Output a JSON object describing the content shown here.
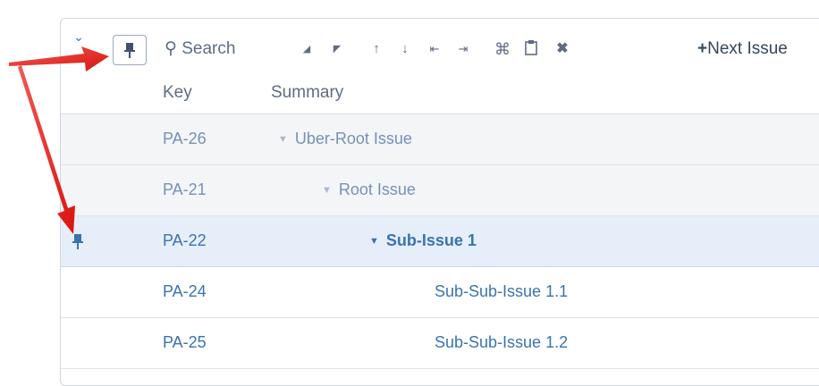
{
  "toolbar": {
    "search_label": "Search",
    "next_issue_label": "Next Issue",
    "icons": [
      "chevron-down-icon",
      "pin-icon",
      "search-icon",
      "collapse-all-icon",
      "expand-all-icon",
      "move-up-icon",
      "move-down-icon",
      "outdent-icon",
      "indent-icon",
      "cut-icon",
      "paste-icon",
      "delete-icon",
      "plus-icon"
    ]
  },
  "columns": {
    "key": "Key",
    "summary": "Summary"
  },
  "rows": [
    {
      "key": "PA-26",
      "summary": "Uber-Root Issue"
    },
    {
      "key": "PA-21",
      "summary": "Root Issue"
    },
    {
      "key": "PA-22",
      "summary": "Sub-Issue 1"
    },
    {
      "key": "PA-24",
      "summary": "Sub-Sub-Issue 1.1"
    },
    {
      "key": "PA-25",
      "summary": "Sub-Sub-Issue 1.2"
    }
  ],
  "colors": {
    "accent": "#3b73af",
    "selected_row": "#e6eefa",
    "faded_row": "#f4f5f7",
    "callout_arrow": "#e8231f"
  }
}
